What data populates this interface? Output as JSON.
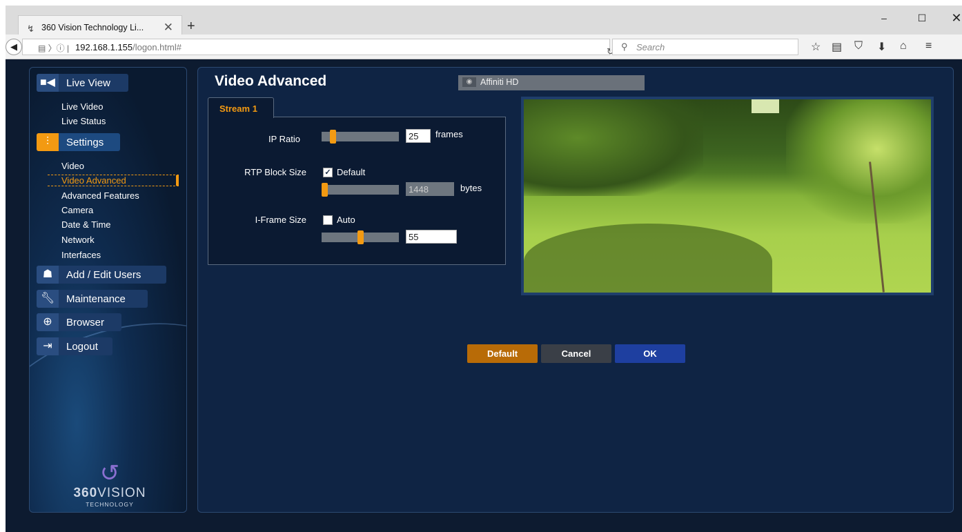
{
  "browser": {
    "tab_title": "360 Vision Technology Li...",
    "tab_close": "✕",
    "new_tab": "+",
    "url_host": "192.168.1.155",
    "url_path": "/logon.html#",
    "search_placeholder": "Search"
  },
  "window": {
    "minimize": "–",
    "maximize": "☐",
    "close": "✕"
  },
  "sidebar": {
    "live_view": {
      "label": "Live View",
      "items": [
        "Live Video",
        "Live Status"
      ]
    },
    "settings": {
      "label": "Settings",
      "items": [
        "Video",
        "Video Advanced",
        "Advanced Features",
        "Camera",
        "Date & Time",
        "Network",
        "Interfaces"
      ],
      "selected": "Video Advanced"
    },
    "add_edit_users": "Add / Edit Users",
    "maintenance": "Maintenance",
    "browser": "Browser",
    "logout": "Logout",
    "logo": {
      "name_bold": "360",
      "name_rest": "VISION",
      "sub": "TECHNOLOGY"
    }
  },
  "main": {
    "title": "Video Advanced",
    "camera_select": "Affiniti HD",
    "tab_label": "Stream 1",
    "ip_ratio": {
      "label": "IP Ratio",
      "value": "25",
      "unit": "frames",
      "slider_fraction": 0.12
    },
    "rtp_block_size": {
      "label": "RTP Block Size",
      "checkbox_label": "Default",
      "checked": true,
      "value": "1448",
      "unit": "bytes",
      "slider_fraction": 0.0
    },
    "iframe_size": {
      "label": "I-Frame Size",
      "checkbox_label": "Auto",
      "checked": false,
      "value": "55",
      "slider_fraction": 0.5
    }
  },
  "buttons": {
    "default": "Default",
    "cancel": "Cancel",
    "ok": "OK"
  },
  "colors": {
    "accent": "#f39a12",
    "background": "#0d1b30",
    "ok_button": "#1e3fa0",
    "default_button": "#b86b07"
  }
}
